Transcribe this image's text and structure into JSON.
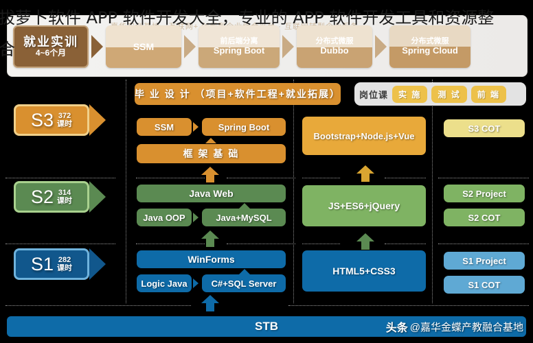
{
  "page_title_line1": "拔萝卜软件 APP 软件开发大全，专业的 APP 软件开发工具和资源整",
  "page_title_line2": "合",
  "banner": {
    "watermark": "嘉华实训基地 · 互联网+ 创新型企业综合平台 · 互联网转型企业服务",
    "chips": [
      {
        "line1": "就业实训",
        "line2": "4~6个月"
      },
      {
        "line1": "",
        "line2": "SSM"
      },
      {
        "line1": "前后端分离",
        "line2": "Spring Boot"
      },
      {
        "line1": "分布式微服",
        "line2": "Dubbo"
      },
      {
        "line1": "分布式微服",
        "line2": "Spring Cloud"
      }
    ]
  },
  "stages": [
    {
      "code": "S3",
      "hours": "372",
      "unit": "课时",
      "color": "#d9902f",
      "border": "#f0d08a"
    },
    {
      "code": "S2",
      "hours": "314",
      "unit": "课时",
      "color": "#5b8a52",
      "border": "#a9d18e"
    },
    {
      "code": "S1",
      "hours": "282",
      "unit": "课时",
      "color": "#11578c",
      "border": "#6fb3dd"
    }
  ],
  "job_panel": {
    "label": "岗位课",
    "pills": [
      "实 施",
      "测 试",
      "前 端"
    ]
  },
  "center_column": {
    "capstone": "毕 业 设 计 （项目+软件工程+就业拓展）",
    "s3": {
      "left": "SSM",
      "right": "Spring Boot",
      "base": "框 架 基 础"
    },
    "s2": {
      "top": "Java Web",
      "left": "Java OOP",
      "right": "Java+MySQL"
    },
    "s1": {
      "top": "WinForms",
      "left": "Logic Java",
      "right": "C#+SQL Server"
    }
  },
  "web_column": {
    "s3": "Bootstrap+Node.js+Vue",
    "s2": "JS+ES6+jQuery",
    "s1": "HTML5+CSS3"
  },
  "right_column": {
    "s3": [
      "S3 COT"
    ],
    "s2": [
      "S2 Project",
      "S2 COT"
    ],
    "s1": [
      "S1 Project",
      "S1 COT"
    ]
  },
  "footer": {
    "stb": "STB",
    "watermark_brand": "头条",
    "watermark_account": "@嘉华金蝶产教融合基地"
  },
  "colors": {
    "orange": "#d9902f",
    "orange_light": "#e8a93a",
    "green": "#5b8a52",
    "green_light": "#7fb363",
    "blue": "#0e6ba8",
    "blue_light": "#5fa9d4",
    "yellow": "#ecdf8b",
    "banner_brown": "#8a6137"
  }
}
